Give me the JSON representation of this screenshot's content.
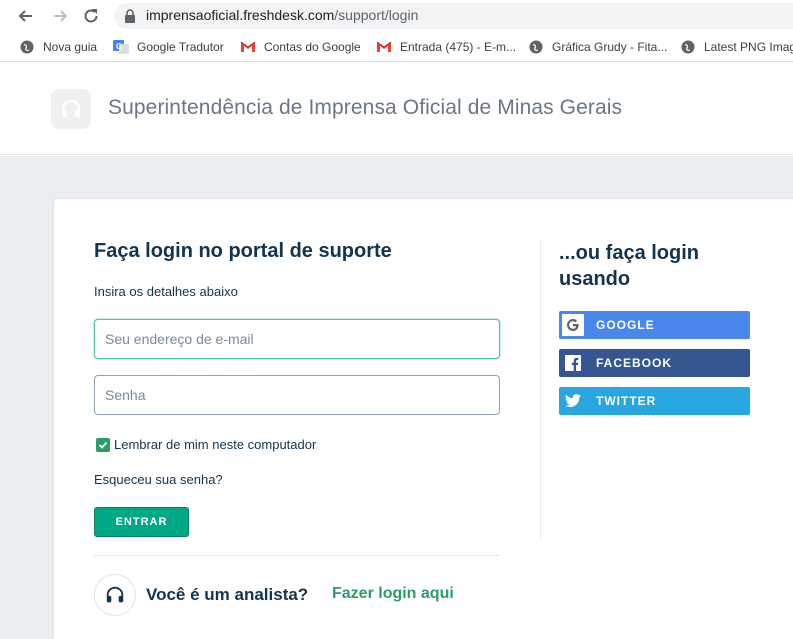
{
  "browser": {
    "url_host": "imprensaoficial.freshdesk.com",
    "url_path": "/support/login",
    "bookmarks": [
      {
        "label": "Nova guia",
        "icon": "globe-icon"
      },
      {
        "label": "Google Tradutor",
        "icon": "google-translate-icon"
      },
      {
        "label": "Contas do Google",
        "icon": "gmail-icon"
      },
      {
        "label": "Entrada (475) - E-m...",
        "icon": "gmail-icon"
      },
      {
        "label": "Gráfica Grudy - Fita...",
        "icon": "globe-icon"
      },
      {
        "label": "Latest PNG Imag",
        "icon": "globe-icon"
      }
    ]
  },
  "header": {
    "site_title": "Superintendência de Imprensa Oficial de Minas Gerais"
  },
  "login": {
    "title": "Faça login no portal de suporte",
    "subtitle": "Insira os detalhes abaixo",
    "email_placeholder": "Seu endereço de e-mail",
    "password_placeholder": "Senha",
    "remember_label": "Lembrar de mim neste computador",
    "remember_checked": true,
    "forgot_label": "Esqueceu sua senha?",
    "submit_label": "ENTRAR"
  },
  "agent": {
    "question": "Você é um analista?",
    "link_label": "Fazer login aqui"
  },
  "social": {
    "title": "...ou faça login usando",
    "google_label": "GOOGLE",
    "facebook_label": "FACEBOOK",
    "twitter_label": "TWITTER"
  },
  "colors": {
    "primary_text": "#12344d",
    "accent_green": "#00a886",
    "google": "#4a87ed",
    "facebook": "#355691",
    "twitter": "#29a6e0"
  }
}
